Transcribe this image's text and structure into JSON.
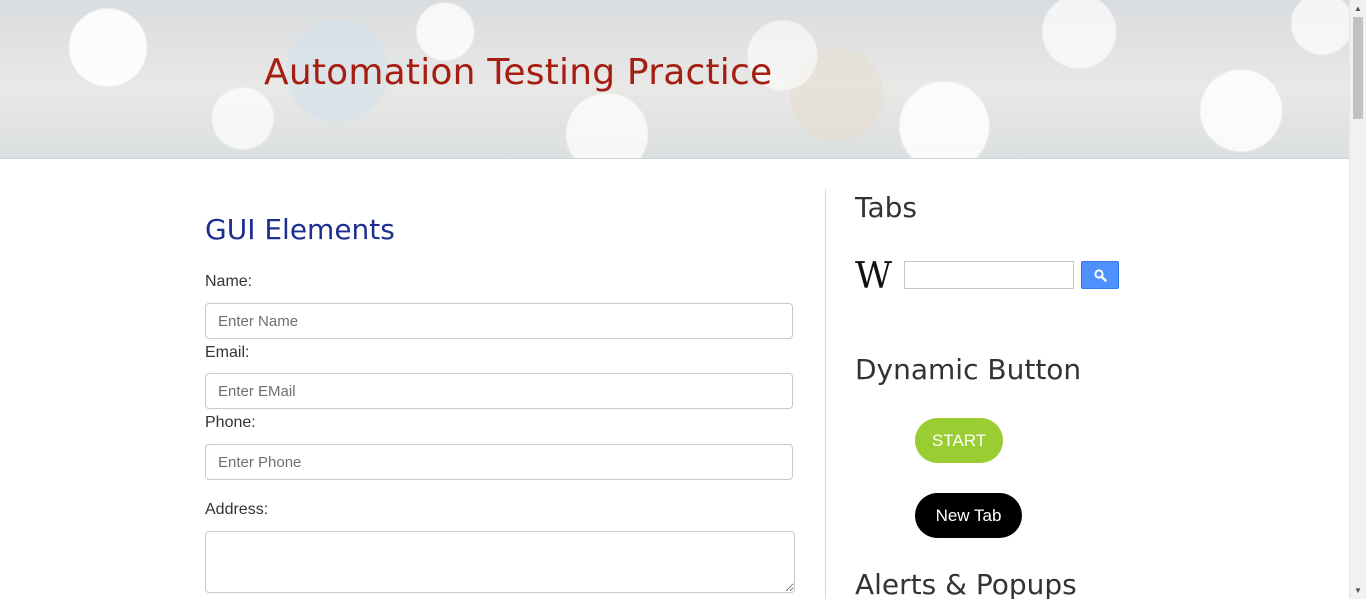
{
  "header": {
    "title": "Automation Testing Practice"
  },
  "gui": {
    "title": "GUI Elements",
    "name_label": "Name:",
    "name_placeholder": "Enter Name",
    "email_label": "Email:",
    "email_placeholder": "Enter EMail",
    "phone_label": "Phone:",
    "phone_placeholder": "Enter Phone",
    "address_label": "Address:"
  },
  "sidebar": {
    "tabs_title": "Tabs",
    "wiki_logo_text": "W",
    "dynamic_title": "Dynamic Button",
    "start_label": "START",
    "newtab_label": "New Tab",
    "alerts_title": "Alerts & Popups"
  },
  "icons": {
    "search": "search-icon",
    "wikipedia": "wikipedia-logo-icon",
    "scroll_up": "chevron-up-icon",
    "scroll_down": "chevron-down-icon"
  },
  "colors": {
    "site_title": "#a61d12",
    "section_title": "#1f2f8f",
    "start_button": "#9acd32",
    "newtab_button": "#000000",
    "search_button": "#4d90fe"
  }
}
